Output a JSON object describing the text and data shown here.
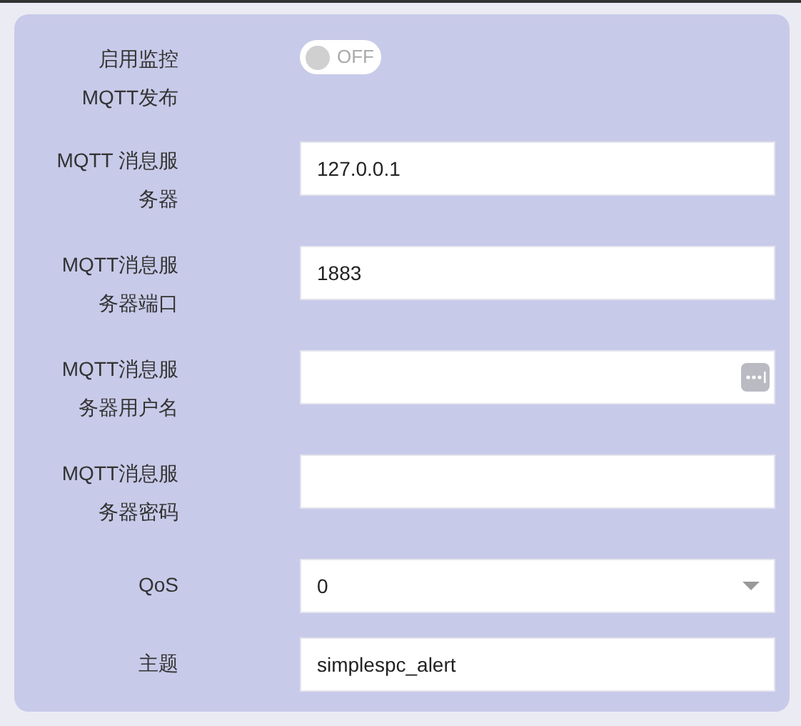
{
  "fields": [
    {
      "kind": "toggle",
      "label": "启用监控MQTT发布",
      "on": false,
      "state_text": "OFF"
    },
    {
      "kind": "text",
      "label": "MQTT 消息服务器",
      "value": "127.0.0.1"
    },
    {
      "kind": "text",
      "label": "MQTT消息服务器端口",
      "value": "1883"
    },
    {
      "kind": "credential",
      "label": "MQTT消息服务器用户名"
    },
    {
      "kind": "text",
      "label": "MQTT消息服务器密码"
    },
    {
      "kind": "select",
      "label": "QoS",
      "value": "0"
    },
    {
      "kind": "text",
      "label": "主题",
      "value": "simplespc_alert"
    }
  ]
}
